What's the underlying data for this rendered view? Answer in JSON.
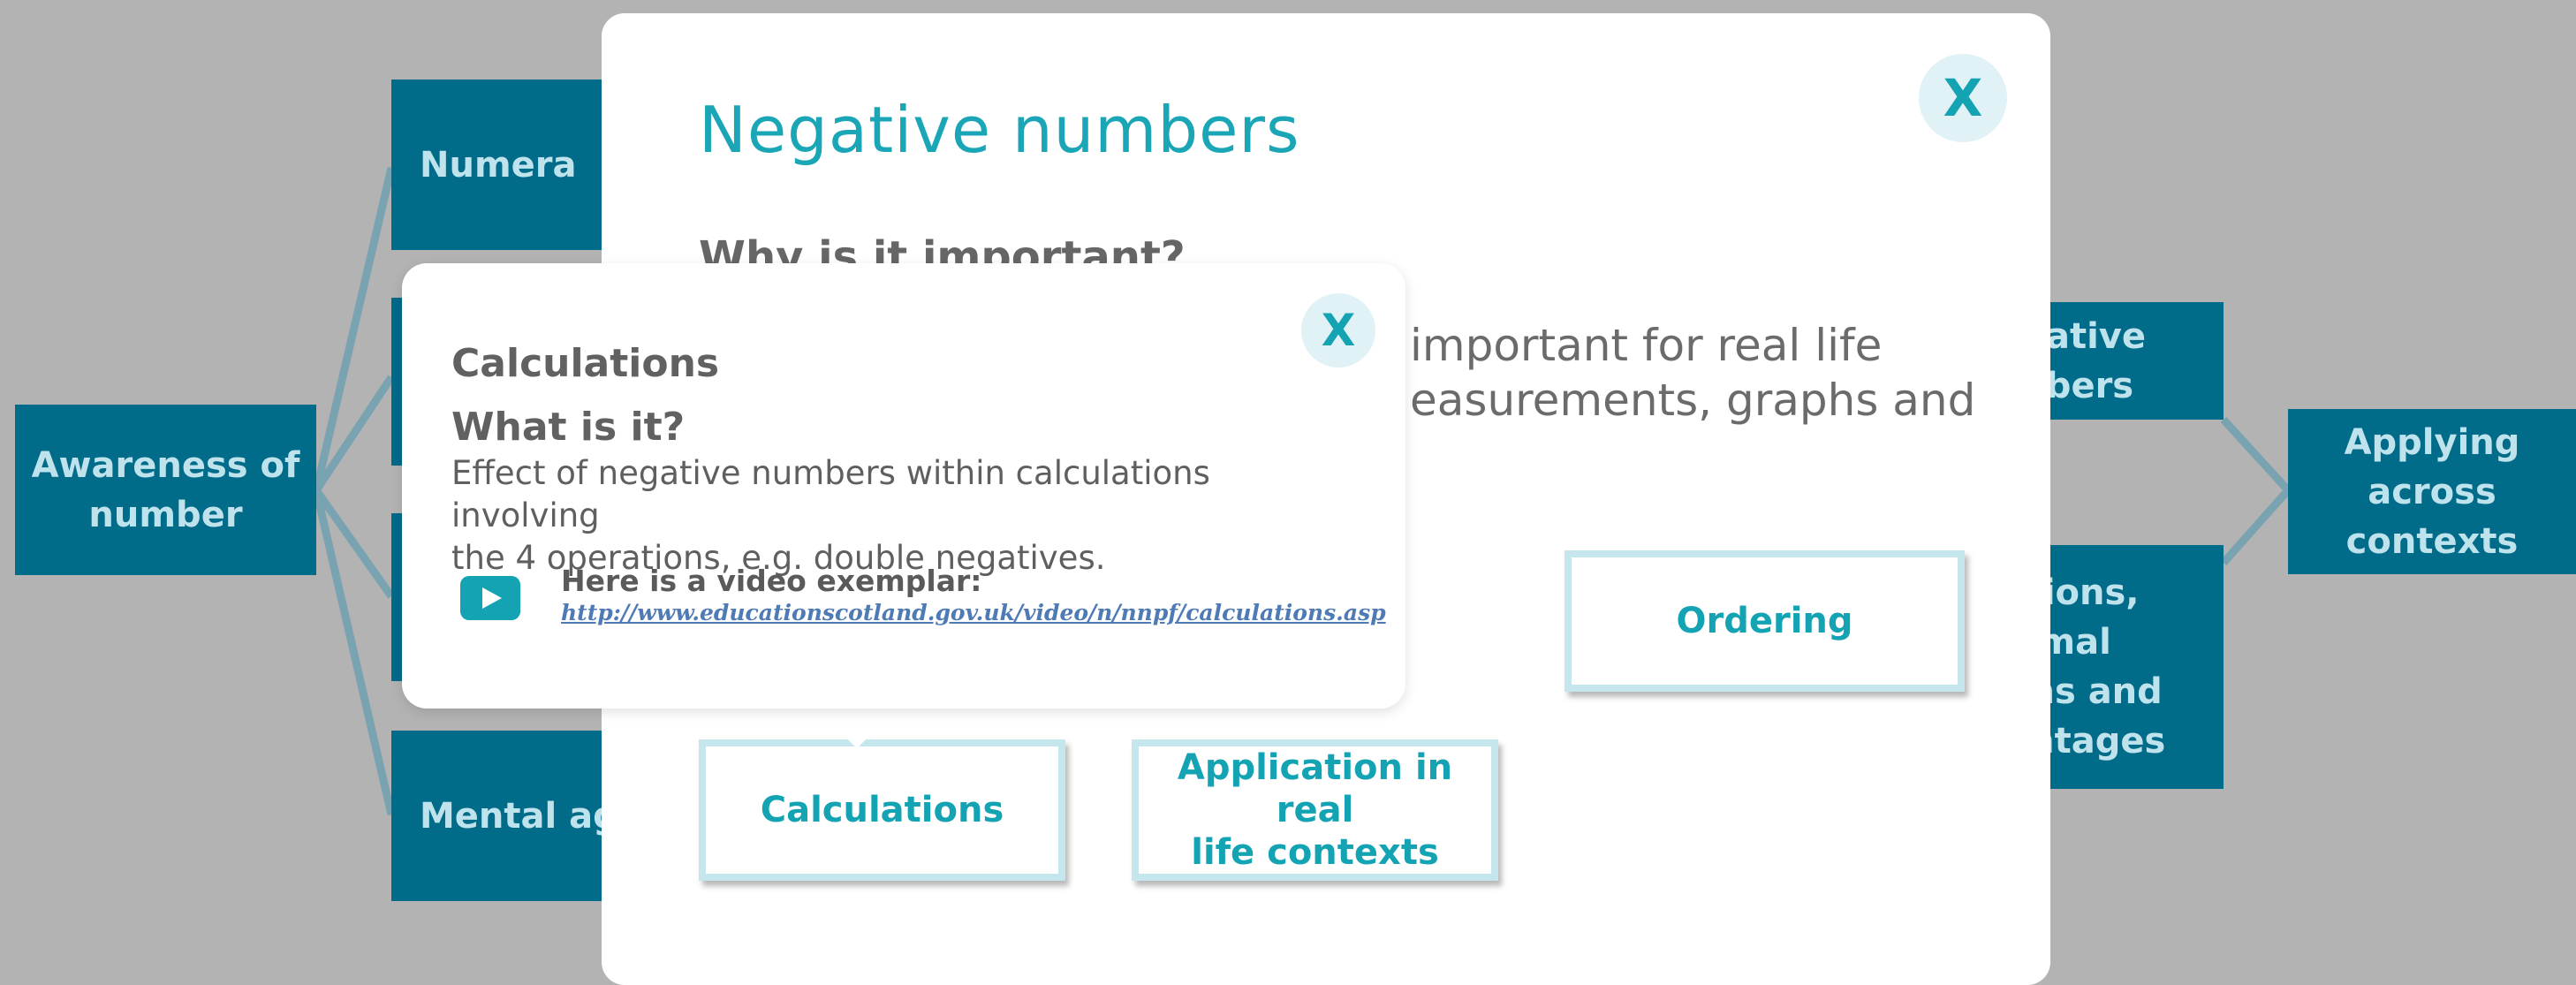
{
  "colors": {
    "node_bg": "#016b8a",
    "node_text": "#bfe3ec",
    "accent": "#14a3b3",
    "overlay_bg": "#b3b3b3"
  },
  "background_map": {
    "root_node": {
      "line1": "Awareness of",
      "line2": "number"
    },
    "left_nodes": [
      "Numera",
      "Mental agi"
    ],
    "right_nodes": {
      "negative": {
        "line1": "gative",
        "line2": "nbers"
      },
      "fractions": {
        "line1": "ctions,",
        "line2": "cimal",
        "line3": "ons and",
        "line4": "entages"
      },
      "applying": {
        "line1": "Applying",
        "line2": "across",
        "line3": "contexts"
      }
    }
  },
  "modal": {
    "title": "Negative numbers",
    "why_heading": "Why is it important?",
    "why_text_line1": "important for real life",
    "why_text_line2": "easurements, graphs and",
    "close_label": "X",
    "topics": {
      "ordering": "Ordering",
      "calculations": "Calculations",
      "application_line1": "Application in real",
      "application_line2": "life contexts"
    }
  },
  "popover": {
    "close_label": "X",
    "title": "Calculations",
    "subtitle": "What is it?",
    "body_line1": "Effect of negative numbers within calculations involving",
    "body_line2": "the 4 operations, e.g. double negatives.",
    "video_label": "Here is a video exemplar:",
    "video_link": "http://www.educationscotland.gov.uk/video/n/nnpf/calculations.asp"
  }
}
